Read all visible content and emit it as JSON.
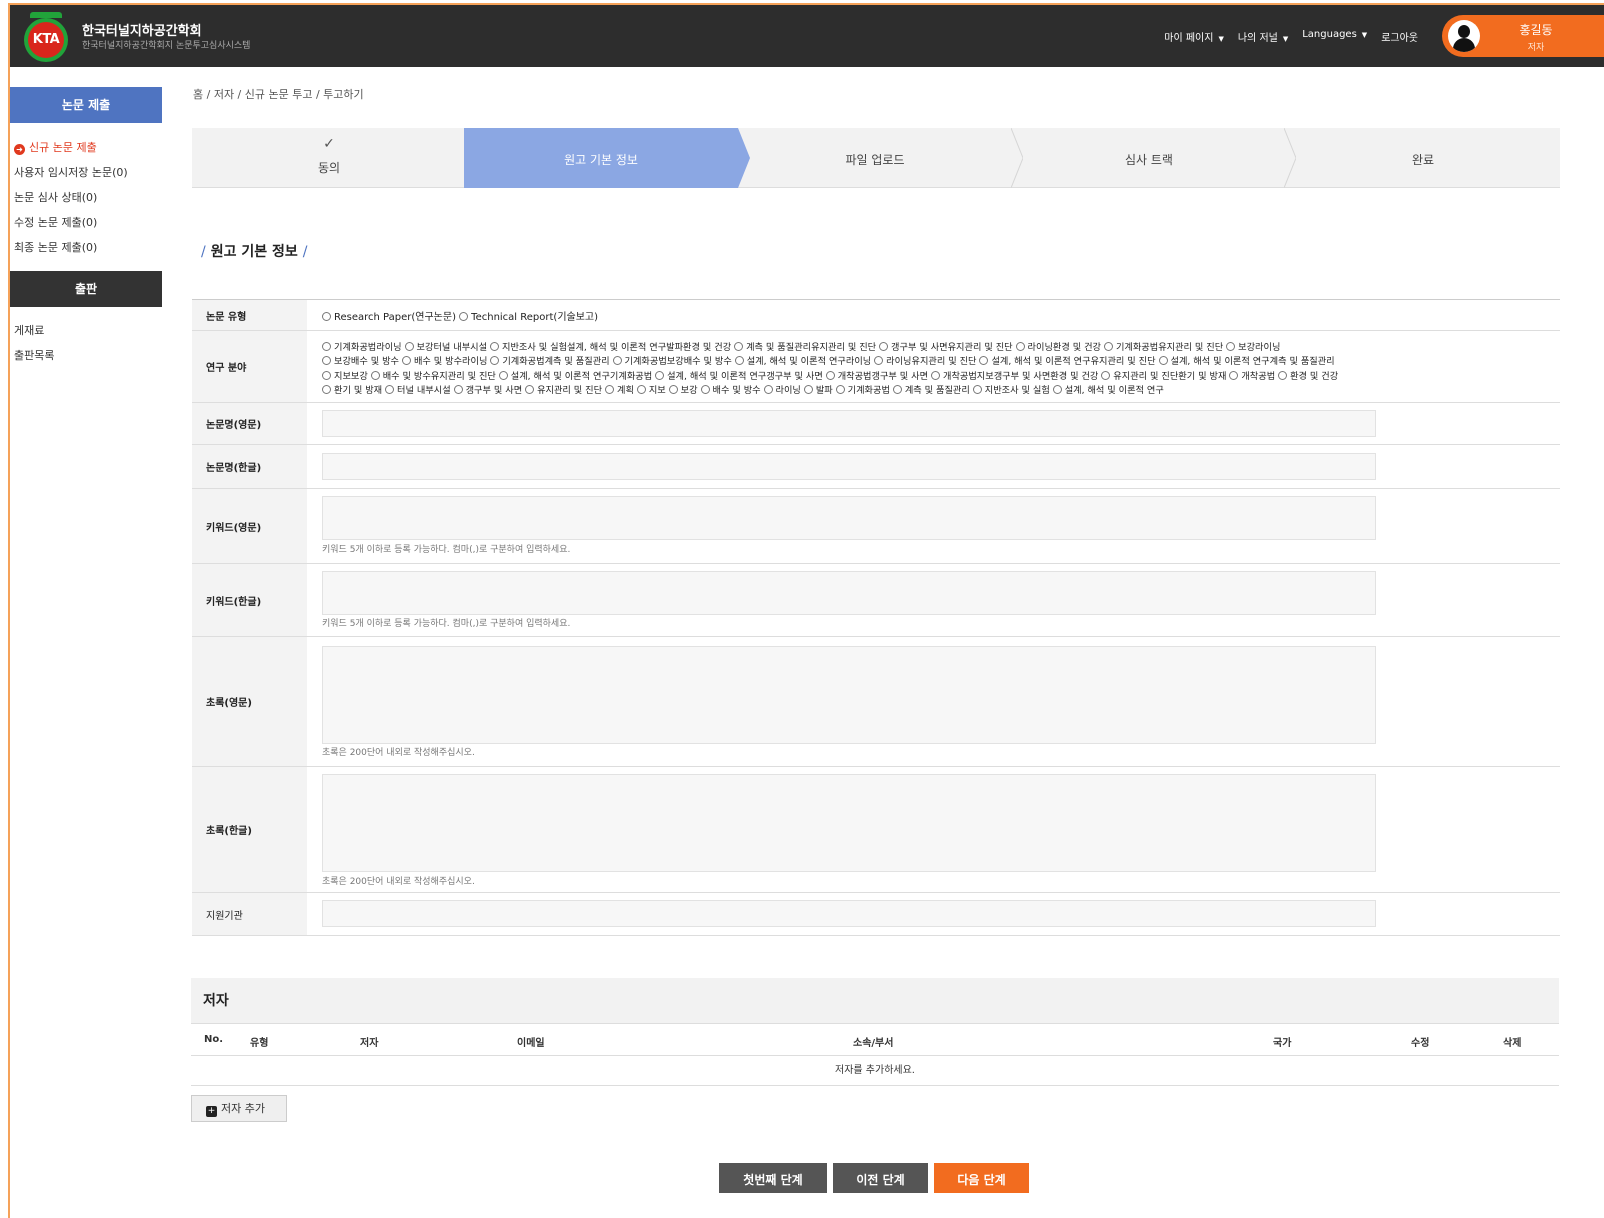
{
  "header": {
    "logo_text": "KTA",
    "title": "한국터널지하공간학회",
    "subtitle": "한국터널지하공간학회지 논문투고심사시스템",
    "nav": [
      "마이 페이지",
      "나의 저널",
      "Languages",
      "로그아웃"
    ],
    "user_name": "홍길동",
    "user_role": "저자"
  },
  "sidebar": {
    "section1_title": "논문 제출",
    "section1_items": [
      "신규 논문 제출",
      "사용자 임시저장 논문(0)",
      "논문 심사 상태(0)",
      "수정 논문 제출(0)",
      "최종 논문 제출(0)"
    ],
    "section2_title": "출판",
    "section2_items": [
      "게재료",
      "출판목록"
    ]
  },
  "breadcrumb": "홈 / 저자 / 신규 논문 투고 / 투고하기",
  "steps": [
    "동의",
    "원고 기본 정보",
    "파일 업로드",
    "심사 트랙",
    "완료"
  ],
  "current_step": 1,
  "section_title": "원고 기본 정보",
  "form": {
    "type_label": "논문 유형",
    "type_options": [
      "Research Paper(연구논문)",
      "Technical Report(기술보고)"
    ],
    "field_label": "연구 분야",
    "field_lines": [
      [
        "기계화공법라이닝",
        "보강터널 내부시설",
        "지반조사 및 실험설계, 해석 및 이론적 연구발파환경 및 건강",
        "계측 및 품질관리유지관리 및 진단",
        "갱구부 및 사면유지관리 및 진단",
        "라이닝환경 및 건강",
        "기계화공법유지관리 및 진단",
        "보강라이닝"
      ],
      [
        "보강배수 및 방수",
        "배수 및 방수라이닝",
        "기계화공법계측 및 품질관리",
        "기계화공법보강배수 및 방수",
        "설계, 해석 및 이론적 연구라이닝",
        "라이닝유지관리 및 진단",
        "설계, 해석 및 이론적 연구유지관리 및 진단",
        "설계, 해석 및 이론적 연구계측 및 품질관리"
      ],
      [
        "지보보강",
        "배수 및 방수유지관리 및 진단",
        "설계, 해석 및 이론적 연구기계화공법",
        "설계, 해석 및 이론적 연구갱구부 및 사면",
        "개착공법갱구부 및 사면",
        "개착공법지보갱구부 및 사면환경 및 건강",
        "유지관리 및 진단환기 및 방재",
        "개착공법",
        "환경 및 건강"
      ],
      [
        "환기 및 방재",
        "터널 내부시설",
        "갱구부 및 사면",
        "유지관리 및 진단",
        "계획",
        "지보",
        "보강",
        "배수 및 방수",
        "라이닝",
        "발파",
        "기계화공법",
        "계측 및 품질관리",
        "지반조사 및 실험",
        "설계, 해석 및 이론적 연구"
      ]
    ],
    "title_en_label": "논문명(영문)",
    "title_ko_label": "논문명(한글)",
    "kw_en_label": "키워드(영문)",
    "kw_ko_label": "키워드(한글)",
    "kw_hint": "키워드 5개 이하로 등록 가능하다. 컴마(,)로 구분하여 입력하세요.",
    "abs_en_label": "초록(영문)",
    "abs_ko_label": "초록(한글)",
    "abs_hint": "초록은 200단어 내외로 작성해주십시오.",
    "funding_label": "지원기관"
  },
  "authors": {
    "title": "저자",
    "columns": [
      "No.",
      "유형",
      "저자",
      "이메일",
      "소속/부서",
      "국가",
      "수정",
      "삭제"
    ],
    "empty": "저자를 추가하세요.",
    "add_label": "저자 추가"
  },
  "buttons": {
    "first": "첫번째 단계",
    "prev": "이전 단계",
    "next": "다음 단계"
  },
  "colors": {
    "accent_blue": "#4f74c1",
    "step_current": "#8ba7e3",
    "orange": "#f26c1f",
    "header_bg": "#2d2d2d"
  }
}
